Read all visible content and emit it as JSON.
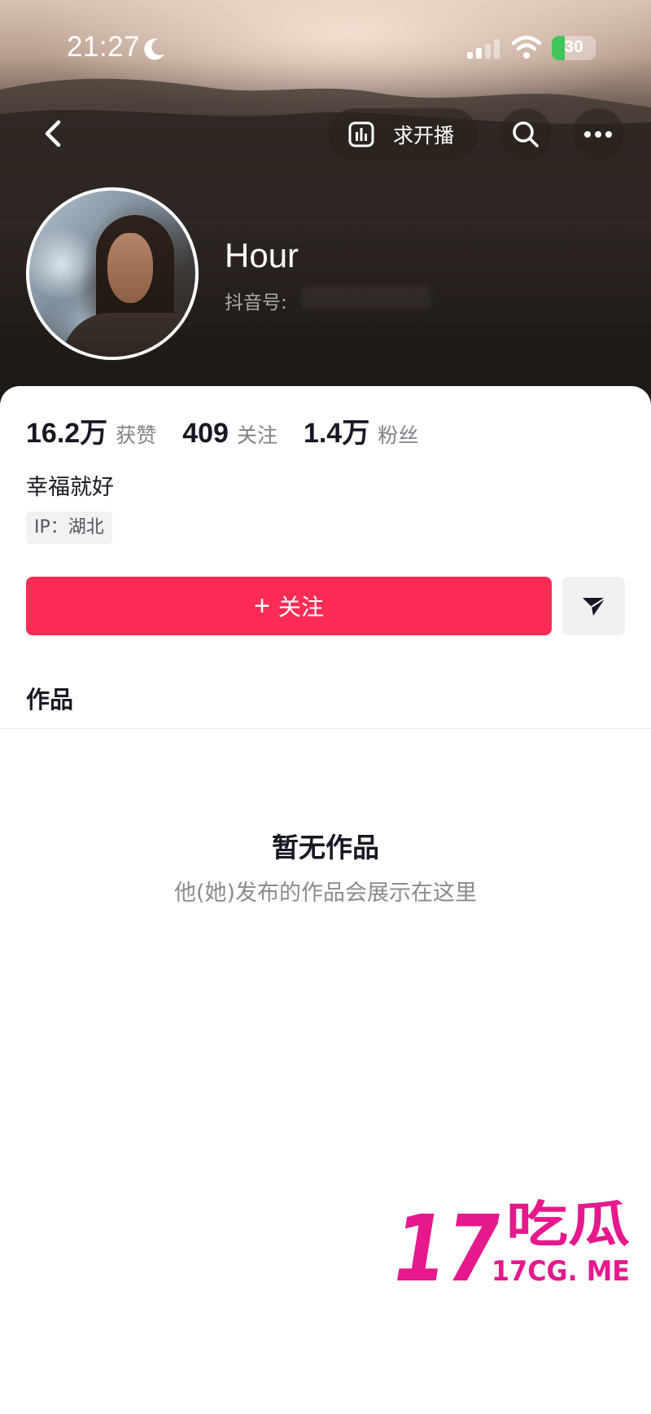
{
  "status_bar": {
    "time": "21:27",
    "battery_level": "30",
    "battery_fraction": 0.3,
    "icons": [
      "moon-icon",
      "signal-icon",
      "wifi-icon",
      "battery-icon"
    ]
  },
  "nav": {
    "icons": [
      "back-icon",
      "live-chart-icon",
      "search-icon",
      "more-icon"
    ],
    "live_label": "求开播"
  },
  "profile": {
    "nickname": "Hour",
    "douyin_id_label": "抖音号:"
  },
  "stats": [
    {
      "value": "16.2万",
      "label": "获赞"
    },
    {
      "value": "409",
      "label": "关注"
    },
    {
      "value": "1.4万",
      "label": "粉丝"
    }
  ],
  "bio": "幸福就好",
  "ip_tag": "IP：湖北",
  "actions": {
    "follow_plus": "+",
    "follow_label": "关注",
    "message_icon": "send-icon"
  },
  "tabs": {
    "works_label": "作品"
  },
  "empty_state": {
    "title": "暂无作品",
    "description": "他(她)发布的作品会展示在这里"
  },
  "watermark": {
    "big": "17吃瓜",
    "small": "17CG. ME"
  },
  "colors": {
    "accent": "#fe2c55",
    "battery_green": "#3fc55a",
    "watermark": "#e6198c"
  }
}
